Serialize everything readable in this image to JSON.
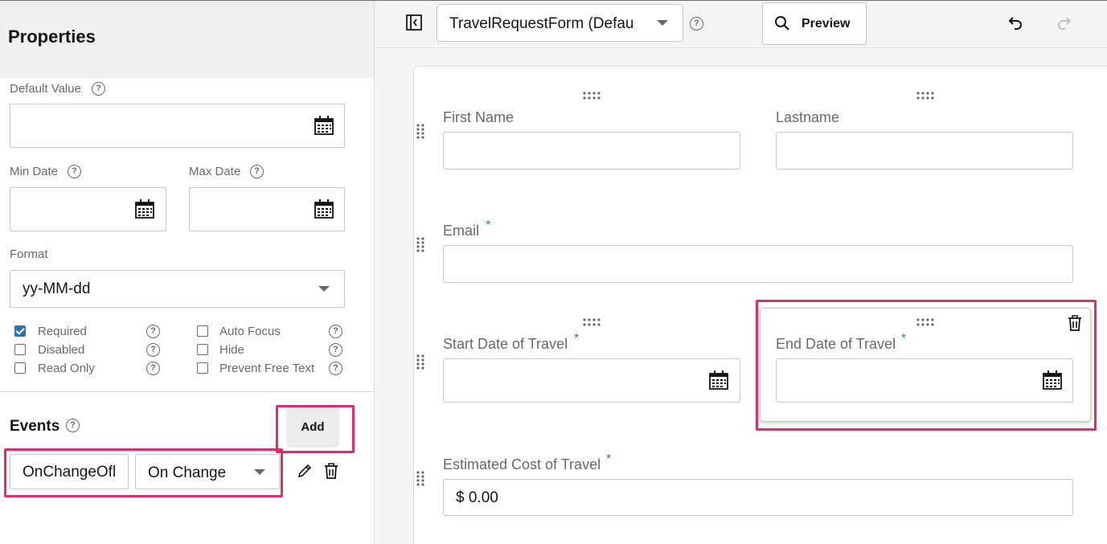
{
  "properties": {
    "title": "Properties",
    "default_value": {
      "label": "Default Value",
      "value": ""
    },
    "min_date": {
      "label": "Min Date",
      "value": ""
    },
    "max_date": {
      "label": "Max Date",
      "value": ""
    },
    "format": {
      "label": "Format",
      "value": "yy-MM-dd"
    },
    "checkboxes": [
      {
        "label": "Required",
        "checked": true
      },
      {
        "label": "Disabled",
        "checked": false
      },
      {
        "label": "Read Only",
        "checked": false
      },
      {
        "label": "Auto Focus",
        "checked": false
      },
      {
        "label": "Hide",
        "checked": false
      },
      {
        "label": "Prevent Free Text",
        "checked": false
      }
    ]
  },
  "events": {
    "title": "Events",
    "add_label": "Add",
    "rows": [
      {
        "name": "OnChangeOfl",
        "trigger": "On Change"
      }
    ]
  },
  "toolbar": {
    "form_name": "TravelRequestForm (Default)",
    "preview_label": "Preview"
  },
  "form": {
    "fields": [
      {
        "label": "First Name",
        "required": false
      },
      {
        "label": "Lastname",
        "required": false
      },
      {
        "label": "Email",
        "required": true
      },
      {
        "label": "Start Date of Travel",
        "required": true
      },
      {
        "label": "End Date of Travel",
        "required": true
      },
      {
        "label": "Estimated Cost of Travel",
        "required": true,
        "value": "$ 0.00"
      }
    ],
    "required_marker": "*"
  },
  "colors": {
    "highlight": "#e8286a",
    "required_marker": "#2f8c4a",
    "checkbox_checked": "#2e6fb8"
  }
}
